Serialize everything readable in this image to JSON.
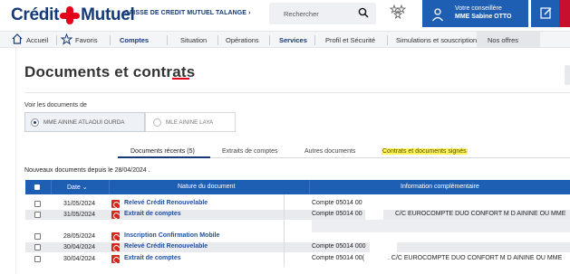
{
  "header": {
    "brand_part1": "Crédit",
    "brand_part2": "Mutuel",
    "bank_link": "CAISSE DE CREDIT MUTUEL TALANGE ›",
    "search_placeholder": "Rechercher",
    "advisor_label": "Votre conseillère",
    "advisor_name": "MME Sabine OTTO",
    "accent_color": "#1f5fb3",
    "brand_red": "#e2001a"
  },
  "nav": {
    "items": [
      {
        "label": "Accueil",
        "icon": "home-icon"
      },
      {
        "label": "Favoris",
        "icon": "star-icon"
      },
      {
        "label": "Comptes"
      },
      {
        "label": "Situation"
      },
      {
        "label": "Opérations"
      },
      {
        "label": "Services"
      },
      {
        "label": "Profil et Sécurité"
      },
      {
        "label": "Simulations et souscriptions"
      },
      {
        "label": "Nos offres"
      }
    ]
  },
  "page": {
    "title": "Documents et contrats",
    "voir_label": "Voir les documents de",
    "persons": [
      {
        "label": "MME AININE ATLAOUI OURDA",
        "selected": true
      },
      {
        "label": "MLE AININE LAYA",
        "selected": false
      }
    ],
    "tabs": [
      {
        "label": "Documents récents (5)",
        "active": true
      },
      {
        "label": "Extraits de comptes",
        "active": false
      },
      {
        "label": "Autres documents",
        "active": false
      },
      {
        "label": "Contrats et documents signés",
        "active": false,
        "highlighted": true
      }
    ],
    "since_text": "Nouveaux documents depuis le  28/04/2024 ."
  },
  "table": {
    "headers": [
      "Date ⌄",
      "Nature du document",
      "Information complémentaire"
    ],
    "rows": [
      {
        "date": "31/05/2024",
        "nature": "Relevé Crédit Renouvelable",
        "info": "Compte 05014 00",
        "info2": ""
      },
      {
        "date": "31/05/2024",
        "nature": "Extrait de comptes",
        "info": "Compte 05014 00",
        "info2": "C/C EUROCOMPTE DUO CONFORT M D AININE OU MME"
      },
      {
        "date": "28/05/2024",
        "nature": "Inscription Confirmation Mobile",
        "info": "",
        "info2": ""
      },
      {
        "date": "30/04/2024",
        "nature": "Relevé Crédit Renouvelable",
        "info": "Compte 05014 000",
        "info2": ""
      },
      {
        "date": "30/04/2024",
        "nature": "Extrait de comptes",
        "info": "Compte 05014 00(",
        "info2": ". C/C EUROCOMPTE DUO CONFORT M D AININE OU MME"
      }
    ]
  }
}
